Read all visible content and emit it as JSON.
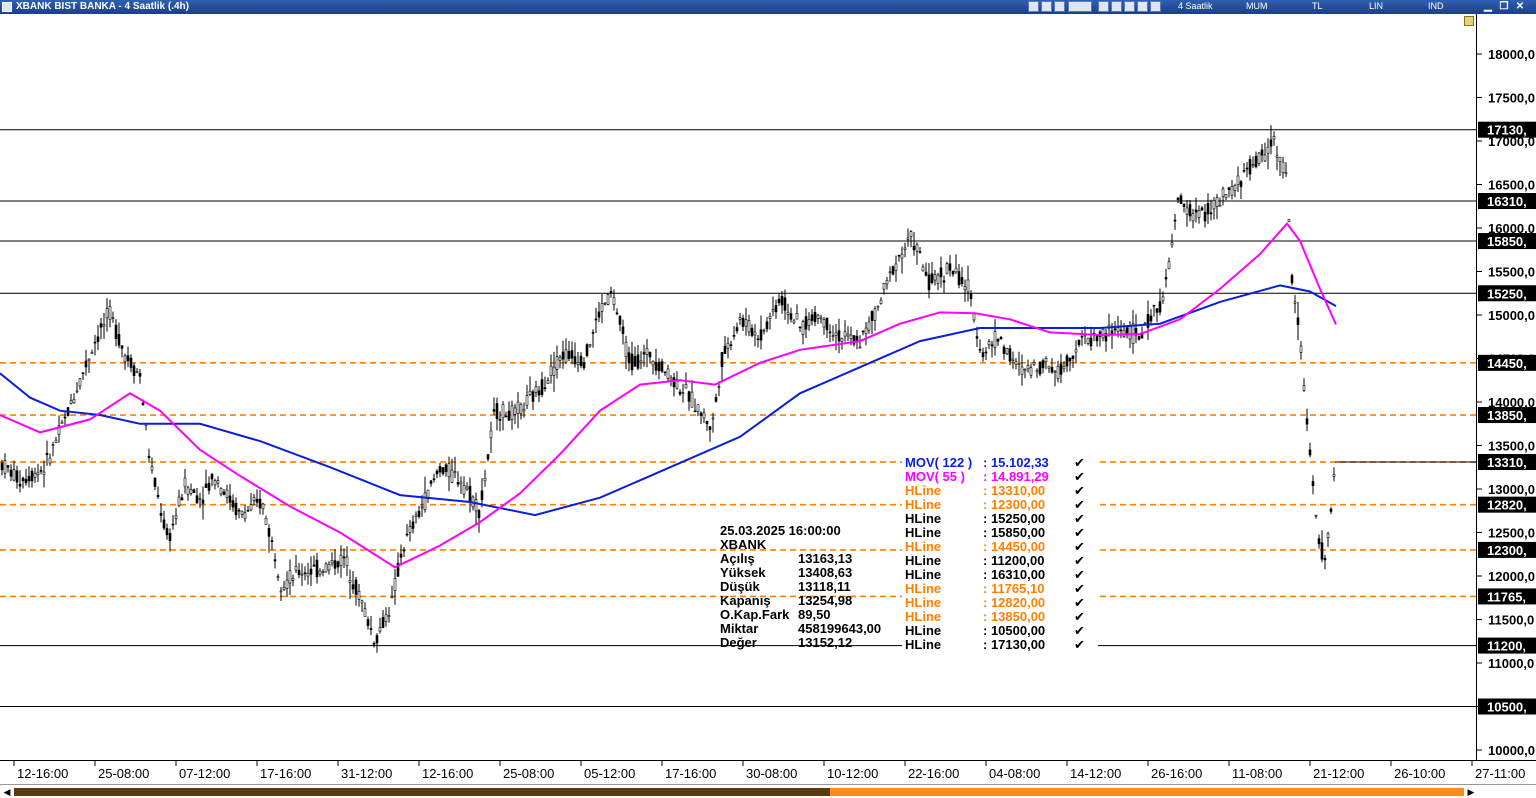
{
  "window": {
    "title": "XBANK BIST BANKA - 4 Saatlik (.4h)",
    "menu": [
      "4 Saatlik",
      "MUM",
      "TL",
      "LIN",
      "IND"
    ],
    "close_glyph": "✕",
    "restore_glyph": "❐",
    "minimize_glyph": "▁"
  },
  "colors": {
    "candle": "#000000",
    "mov122": "#0a1edc",
    "mov55": "#ff00ff",
    "hline_black": "#000000",
    "hline_orange": "#ff8000",
    "axis_tag_bg": "#000000",
    "axis_tag_text": "#ffffff",
    "scroll_thumb": "#ff8c1a"
  },
  "chart_data": {
    "type": "candlestick",
    "symbol": "XBANK",
    "timeframe": "4 Saatlik (.4h)",
    "y_ticks": [
      "18000,0",
      "17500,0",
      "17000,0",
      "16500,0",
      "16000,0",
      "15500,0",
      "15000,0",
      "14500,0",
      "14000,0",
      "13500,0",
      "13000,0",
      "12500,0",
      "12000,0",
      "11500,0",
      "11000,0",
      "10500,0",
      "10000,0"
    ],
    "x_ticks": [
      "12-16:00",
      "25-08:00",
      "07-12:00",
      "17-16:00",
      "31-12:00",
      "12-16:00",
      "25-08:00",
      "05-12:00",
      "17-16:00",
      "30-08:00",
      "10-12:00",
      "22-16:00",
      "04-08:00",
      "14-12:00",
      "26-16:00",
      "11-08:00",
      "21-12:00",
      "26-10:00",
      "27-11:00"
    ],
    "price_path": [
      [
        0,
        13310
      ],
      [
        20,
        13100
      ],
      [
        45,
        13250
      ],
      [
        65,
        13800
      ],
      [
        95,
        14700
      ],
      [
        110,
        15020
      ],
      [
        125,
        14550
      ],
      [
        140,
        14300
      ],
      [
        150,
        13300
      ],
      [
        168,
        12400
      ],
      [
        185,
        13050
      ],
      [
        200,
        12900
      ],
      [
        215,
        13150
      ],
      [
        240,
        12700
      ],
      [
        262,
        12850
      ],
      [
        282,
        11900
      ],
      [
        300,
        12050
      ],
      [
        320,
        12080
      ],
      [
        345,
        12200
      ],
      [
        360,
        11750
      ],
      [
        375,
        11250
      ],
      [
        392,
        11700
      ],
      [
        402,
        12300
      ],
      [
        420,
        12750
      ],
      [
        440,
        13250
      ],
      [
        462,
        13100
      ],
      [
        480,
        12750
      ],
      [
        495,
        13900
      ],
      [
        515,
        13850
      ],
      [
        540,
        14150
      ],
      [
        562,
        14550
      ],
      [
        585,
        14500
      ],
      [
        600,
        15050
      ],
      [
        612,
        15250
      ],
      [
        630,
        14450
      ],
      [
        650,
        14550
      ],
      [
        670,
        14300
      ],
      [
        690,
        14050
      ],
      [
        712,
        13700
      ],
      [
        722,
        14500
      ],
      [
        740,
        14950
      ],
      [
        760,
        14750
      ],
      [
        780,
        15200
      ],
      [
        800,
        14850
      ],
      [
        818,
        15000
      ],
      [
        840,
        14750
      ],
      [
        860,
        14700
      ],
      [
        875,
        15000
      ],
      [
        895,
        15600
      ],
      [
        912,
        15900
      ],
      [
        930,
        15350
      ],
      [
        950,
        15550
      ],
      [
        968,
        15300
      ],
      [
        982,
        14550
      ],
      [
        998,
        14750
      ],
      [
        1020,
        14350
      ],
      [
        1045,
        14450
      ],
      [
        1060,
        14350
      ],
      [
        1080,
        14700
      ],
      [
        1100,
        14750
      ],
      [
        1120,
        14850
      ],
      [
        1140,
        14750
      ],
      [
        1150,
        14950
      ],
      [
        1165,
        15250
      ],
      [
        1178,
        16300
      ],
      [
        1195,
        16150
      ],
      [
        1210,
        16200
      ],
      [
        1230,
        16400
      ],
      [
        1250,
        16700
      ],
      [
        1265,
        16850
      ],
      [
        1273,
        17050
      ],
      [
        1287,
        16550
      ],
      [
        1292,
        15400
      ],
      [
        1300,
        14750
      ],
      [
        1310,
        13400
      ],
      [
        1318,
        12400
      ],
      [
        1326,
        12150
      ],
      [
        1335,
        13310
      ]
    ],
    "indicators": [
      {
        "name": "MOV( 122 )",
        "value": "15.102,33",
        "path": [
          [
            0,
            14330
          ],
          [
            30,
            14050
          ],
          [
            60,
            13900
          ],
          [
            100,
            13850
          ],
          [
            140,
            13750
          ],
          [
            200,
            13750
          ],
          [
            260,
            13550
          ],
          [
            330,
            13250
          ],
          [
            400,
            12930
          ],
          [
            470,
            12850
          ],
          [
            535,
            12700
          ],
          [
            600,
            12900
          ],
          [
            680,
            13300
          ],
          [
            740,
            13600
          ],
          [
            800,
            14100
          ],
          [
            860,
            14400
          ],
          [
            920,
            14700
          ],
          [
            980,
            14850
          ],
          [
            1040,
            14850
          ],
          [
            1100,
            14850
          ],
          [
            1160,
            14900
          ],
          [
            1220,
            15150
          ],
          [
            1280,
            15340
          ],
          [
            1310,
            15270
          ],
          [
            1336,
            15102
          ]
        ]
      },
      {
        "name": "MOV( 55 )",
        "value": "14.891,29",
        "path": [
          [
            0,
            13850
          ],
          [
            40,
            13650
          ],
          [
            90,
            13800
          ],
          [
            130,
            14100
          ],
          [
            160,
            13900
          ],
          [
            200,
            13450
          ],
          [
            240,
            13150
          ],
          [
            290,
            12800
          ],
          [
            340,
            12500
          ],
          [
            395,
            12100
          ],
          [
            440,
            12350
          ],
          [
            480,
            12620
          ],
          [
            520,
            12950
          ],
          [
            560,
            13400
          ],
          [
            600,
            13900
          ],
          [
            640,
            14200
          ],
          [
            680,
            14250
          ],
          [
            715,
            14200
          ],
          [
            760,
            14450
          ],
          [
            800,
            14600
          ],
          [
            860,
            14700
          ],
          [
            900,
            14900
          ],
          [
            940,
            15030
          ],
          [
            975,
            15020
          ],
          [
            1010,
            14950
          ],
          [
            1050,
            14800
          ],
          [
            1100,
            14770
          ],
          [
            1140,
            14780
          ],
          [
            1180,
            14950
          ],
          [
            1220,
            15300
          ],
          [
            1260,
            15700
          ],
          [
            1287,
            16050
          ],
          [
            1300,
            15850
          ],
          [
            1320,
            15300
          ],
          [
            1336,
            14891
          ]
        ]
      }
    ],
    "hlines": [
      {
        "label": "HLine",
        "value": "13310,00",
        "price": 13310,
        "style": "dashed",
        "color": "#ff8000",
        "tag": "13310,",
        "x_from": 0,
        "x_to": 1476
      },
      {
        "label": "HLine",
        "value": "12300,00",
        "price": 12300,
        "style": "dashed",
        "color": "#ff8000",
        "tag": "12300,",
        "x_from": 0,
        "x_to": 1476
      },
      {
        "label": "HLine",
        "value": "15250,00",
        "price": 15250,
        "style": "solid",
        "color": "#000000",
        "tag": "15250,",
        "x_from": 0,
        "x_to": 1476
      },
      {
        "label": "HLine",
        "value": "15850,00",
        "price": 15850,
        "style": "solid",
        "color": "#000000",
        "tag": "15850,",
        "x_from": 0,
        "x_to": 1476
      },
      {
        "label": "HLine",
        "value": "14450,00",
        "price": 14450,
        "style": "dashed",
        "color": "#ff8000",
        "tag": "14450,",
        "x_from": 0,
        "x_to": 1476
      },
      {
        "label": "HLine",
        "value": "11200,00",
        "price": 11200,
        "style": "solid",
        "color": "#000000",
        "tag": "11200,",
        "x_from": 0,
        "x_to": 1476
      },
      {
        "label": "HLine",
        "value": "16310,00",
        "price": 16310,
        "style": "solid",
        "color": "#000000",
        "tag": "16310,",
        "x_from": 0,
        "x_to": 1476
      },
      {
        "label": "HLine",
        "value": "11765,10",
        "price": 11765,
        "style": "dashed",
        "color": "#ff8000",
        "tag": "11765,",
        "x_from": 0,
        "x_to": 1476
      },
      {
        "label": "HLine",
        "value": "12820,00",
        "price": 12820,
        "style": "dashed",
        "color": "#ff8000",
        "tag": "12820,",
        "x_from": 0,
        "x_to": 1476
      },
      {
        "label": "HLine",
        "value": "13850,00",
        "price": 13850,
        "style": "dashed",
        "color": "#ff8000",
        "tag": "13850,",
        "x_from": 0,
        "x_to": 1476
      },
      {
        "label": "HLine",
        "value": "10500,00",
        "price": 10500,
        "style": "solid",
        "color": "#000000",
        "tag": "10500,",
        "x_from": 0,
        "x_to": 1476
      },
      {
        "label": "HLine",
        "value": "17130,00",
        "price": 17130,
        "style": "solid",
        "color": "#000000",
        "tag": "17130,",
        "x_from": 0,
        "x_to": 1476
      }
    ],
    "ohlc_box": {
      "datetime": "25.03.2025  16:00:00",
      "symbol": "XBANK",
      "rows": [
        {
          "label": "Açılış",
          "value": "13163,13"
        },
        {
          "label": "Yüksek",
          "value": "13408,63"
        },
        {
          "label": "Düşük",
          "value": "13118,11"
        },
        {
          "label": "Kapanış",
          "value": "13254,98"
        },
        {
          "label": "O.Kap.Fark",
          "value": "89,50"
        },
        {
          "label": "Miktar",
          "value": "458199643,00"
        },
        {
          "label": "Değer",
          "value": "13152,12"
        }
      ]
    }
  }
}
